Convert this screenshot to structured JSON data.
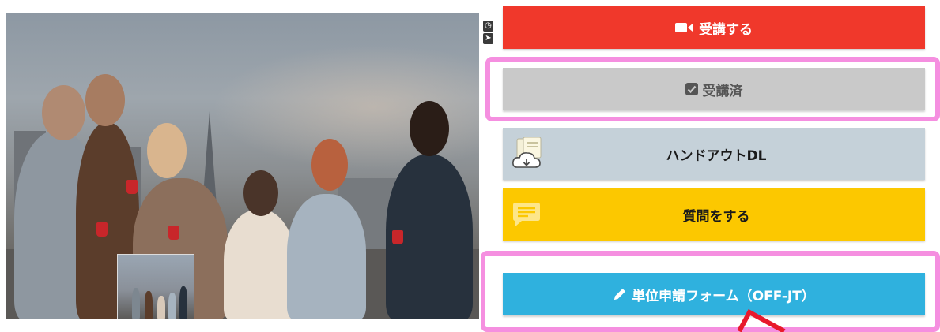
{
  "video": {
    "main_frame_icon": "video-frame",
    "pip_frame_icon": "video-frame",
    "side_icons": [
      "clock-icon",
      "send-arrow-icon"
    ]
  },
  "buttons": {
    "attend": {
      "label": "受講する",
      "icon": "video-camera-icon"
    },
    "completed": {
      "label": "受講済",
      "icon": "checkbox-checked-icon"
    },
    "handout": {
      "label": "ハンドアウトDL",
      "icon": "cloud-download-document-icon"
    },
    "question": {
      "label": "質問をする",
      "icon": "speech-bubble-icon"
    },
    "credit_form": {
      "label": "単位申請フォーム（OFF-JT）",
      "icon": "pencil-icon"
    }
  },
  "colors": {
    "attend": "#f0382b",
    "completed": "#c9c9c9",
    "handout": "#c5d1d9",
    "question": "#fcc800",
    "credit_form": "#2fb1de",
    "highlight": "#f58fe0",
    "arrow": "#e8192c"
  }
}
